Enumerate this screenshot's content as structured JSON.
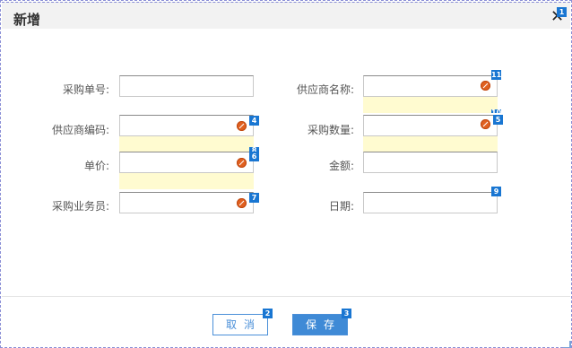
{
  "dialog": {
    "title": "新增",
    "close_glyph": "✕",
    "close_badge": "1"
  },
  "form": {
    "purchase_no": {
      "label": "采购单号:",
      "value": ""
    },
    "supplier_name": {
      "label": "供应商名称:",
      "value": "",
      "badge": "11",
      "badge_under": "10"
    },
    "supplier_code": {
      "label": "供应商编码:",
      "value": "",
      "badge": "4",
      "badge_under": "8"
    },
    "quantity": {
      "label": "采购数量:",
      "value": "",
      "badge": "5"
    },
    "unit_price": {
      "label": "单价:",
      "value": "",
      "badge": "6"
    },
    "amount": {
      "label": "金额:",
      "value": ""
    },
    "salesman": {
      "label": "采购业务员:",
      "value": "",
      "badge": "7"
    },
    "date": {
      "label": "日期:",
      "value": "",
      "badge": "9"
    }
  },
  "buttons": {
    "cancel": {
      "label": "取消",
      "badge": "2"
    },
    "save": {
      "label": "保存",
      "badge": "3"
    }
  },
  "icons": {
    "clear": "clear-icon",
    "close": "close-icon"
  }
}
